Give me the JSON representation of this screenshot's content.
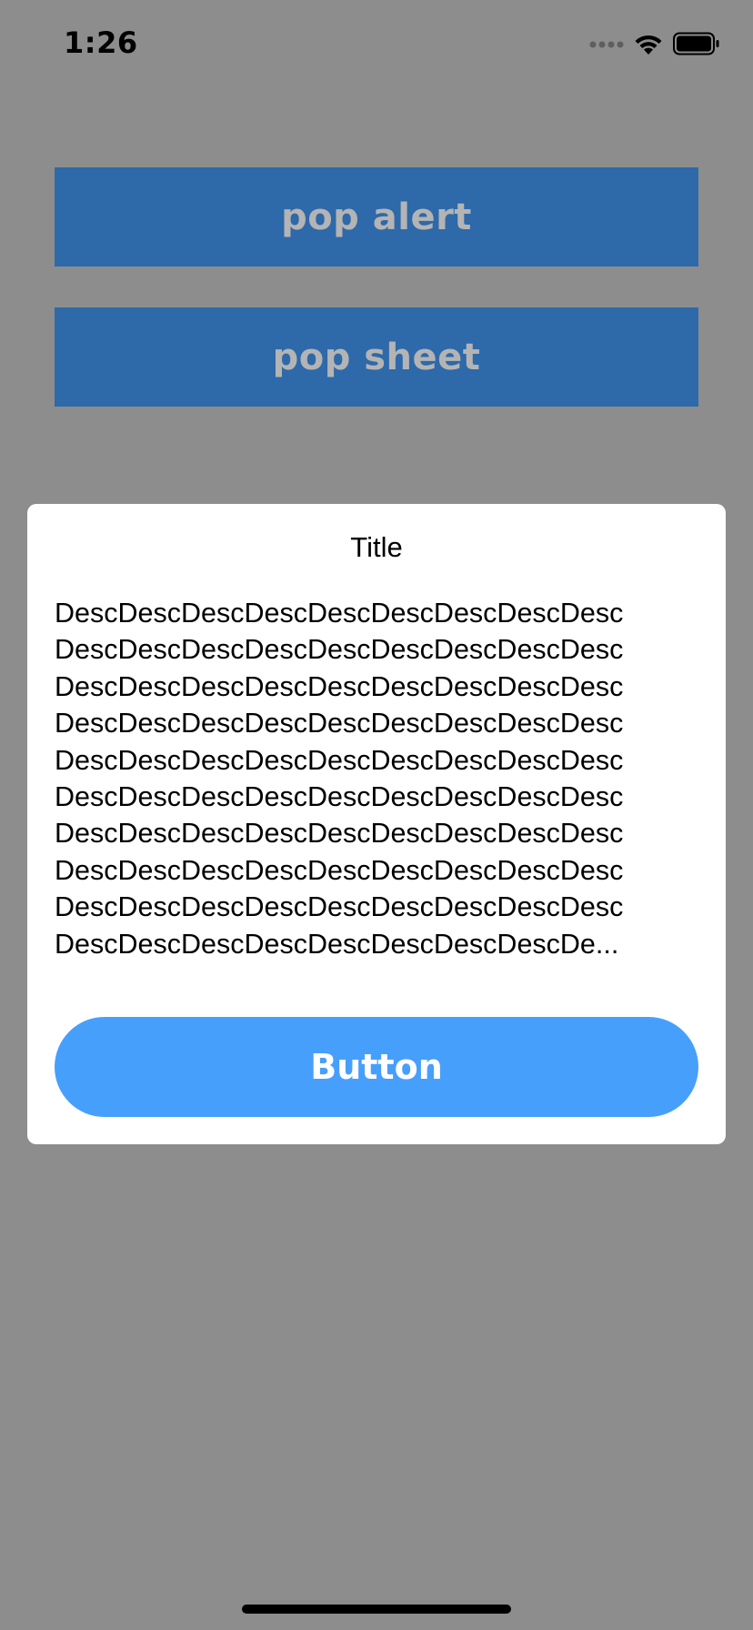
{
  "status_bar": {
    "time": "1:26",
    "icons": [
      "signal-dots-icon",
      "wifi-icon",
      "battery-icon"
    ]
  },
  "background": {
    "pop_alert_label": "pop alert",
    "pop_sheet_label": "pop sheet"
  },
  "alert": {
    "title": "Title",
    "description_lines": [
      "DescDescDescDescDescDescDescDescDesc",
      "DescDescDescDescDescDescDescDescDesc",
      "DescDescDescDescDescDescDescDescDesc",
      "DescDescDescDescDescDescDescDescDesc",
      "DescDescDescDescDescDescDescDescDesc",
      "DescDescDescDescDescDescDescDescDesc",
      "DescDescDescDescDescDescDescDescDesc",
      "DescDescDescDescDescDescDescDescDesc",
      "DescDescDescDescDescDescDescDescDesc",
      "DescDescDescDescDescDescDescDescDe..."
    ],
    "button_label": "Button"
  },
  "colors": {
    "overlay_background": "#8d8d8d",
    "background_button": "#2e69a9",
    "background_button_text": "#b4b4b4",
    "alert_button": "#479ffc",
    "alert_background": "#ffffff"
  }
}
